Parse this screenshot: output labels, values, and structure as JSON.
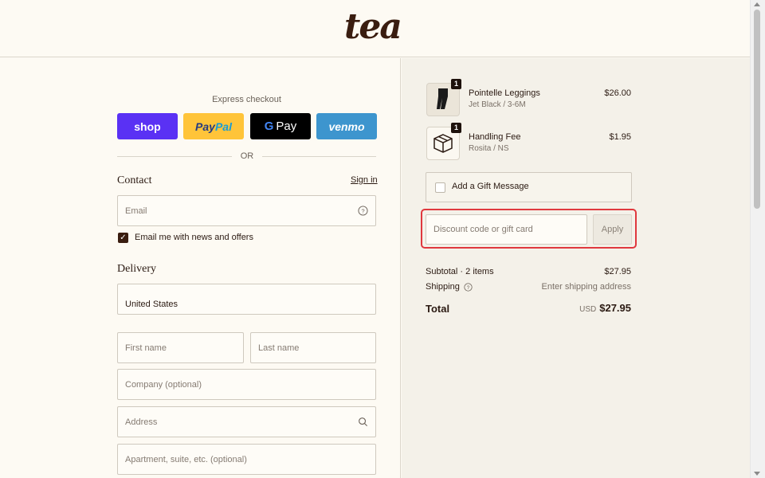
{
  "brand": {
    "logo_text": "tea"
  },
  "express": {
    "label": "Express checkout",
    "shop": "shop",
    "paypal_a": "Pay",
    "paypal_b": "Pal",
    "gpay_g": "G",
    "gpay": "Pay",
    "venmo": "venmo",
    "or": "OR"
  },
  "contact": {
    "title": "Contact",
    "signin": "Sign in",
    "email_placeholder": "Email",
    "newsletter_label": "Email me with news and offers",
    "newsletter_checked": true
  },
  "delivery": {
    "title": "Delivery",
    "country": "United States",
    "first_name_placeholder": "First name",
    "last_name_placeholder": "Last name",
    "company_placeholder": "Company (optional)",
    "address_placeholder": "Address",
    "apartment_placeholder": "Apartment, suite, etc. (optional)"
  },
  "order": {
    "items": [
      {
        "name": "Pointelle Leggings",
        "variant": "Jet Black / 3-6M",
        "price": "$26.00",
        "qty": "1",
        "icon": "leggings-icon"
      },
      {
        "name": "Handling Fee",
        "variant": "Rosita / NS",
        "price": "$1.95",
        "qty": "1",
        "icon": "package-box-icon"
      }
    ],
    "gift_label": "Add a Gift Message",
    "discount_placeholder": "Discount code or gift card",
    "apply_label": "Apply",
    "subtotal_label": "Subtotal · 2 items",
    "subtotal_value": "$27.95",
    "shipping_label": "Shipping",
    "shipping_value": "Enter shipping address",
    "total_label": "Total",
    "currency": "USD",
    "total_value": "$27.95"
  },
  "colors": {
    "highlight": "#e0383e",
    "shop": "#5a31f4",
    "paypal": "#ffc439",
    "venmo": "#3d95ce",
    "brand": "#3a1d10"
  }
}
